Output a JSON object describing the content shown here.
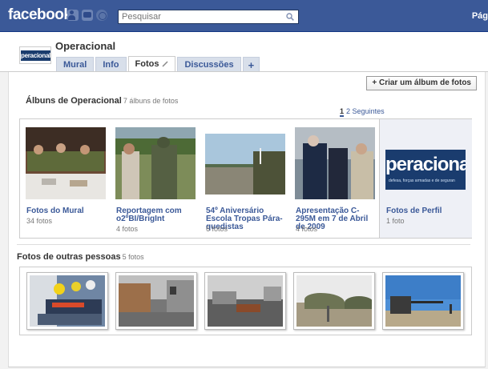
{
  "brand": {
    "logo_text": "facebook"
  },
  "search": {
    "placeholder": "Pesquisar"
  },
  "topbar": {
    "right_link": "Pág"
  },
  "profile": {
    "name": "Operacional",
    "avatar_text": "peracional",
    "tabs": [
      {
        "label": "Mural"
      },
      {
        "label": "Info"
      },
      {
        "label": "Fotos",
        "active": true
      },
      {
        "label": "Discussões"
      },
      {
        "label": "+"
      }
    ]
  },
  "actions": {
    "create_album_label": "+ Criar um álbum de fotos"
  },
  "albums_section": {
    "title": "Álbuns de Operacional",
    "count": "7 álbuns de fotos",
    "pager": {
      "current": "1",
      "next_page": "2",
      "next_label": "Seguintes"
    },
    "albums": [
      {
        "title": "Fotos do Mural",
        "count": "34 fotos"
      },
      {
        "title": "Reportagem com o2ºBI/BrigInt",
        "count": "4 fotos"
      },
      {
        "title": "54º Aniversário Escola Tropas Pára-quedistas",
        "count": "6 fotos"
      },
      {
        "title": "Apresentação C-295M em 7 de Abril de 2009",
        "count": "4 fotos"
      },
      {
        "title": "Fotos de Perfil",
        "count": "1 foto",
        "logo_main": "peracional",
        "logo_sub": "defesa, forças armadas e de seguran"
      }
    ]
  },
  "others_section": {
    "title": "Fotos de outras pessoas",
    "count": "5 fotos"
  },
  "colors": {
    "brand_blue": "#3b5998",
    "link_blue": "#3b5998",
    "tab_bg": "#d8dfea"
  }
}
